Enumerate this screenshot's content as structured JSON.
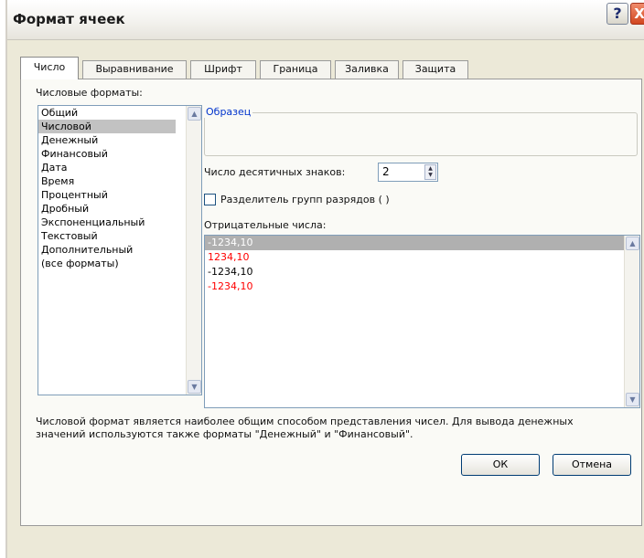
{
  "window": {
    "title": "Формат ячеек",
    "help_symbol": "?",
    "close_symbol": "X"
  },
  "tabs": [
    {
      "label": "Число",
      "active": true
    },
    {
      "label": "Выравнивание",
      "active": false
    },
    {
      "label": "Шрифт",
      "active": false
    },
    {
      "label": "Граница",
      "active": false
    },
    {
      "label": "Заливка",
      "active": false
    },
    {
      "label": "Защита",
      "active": false
    }
  ],
  "number_formats": {
    "label": "Числовые форматы:",
    "items": [
      "Общий",
      "Числовой",
      "Денежный",
      "Финансовый",
      "Дата",
      "Время",
      "Процентный",
      "Дробный",
      "Экспоненциальный",
      "Текстовый",
      "Дополнительный",
      "(все форматы)"
    ],
    "selected": "Числовой"
  },
  "sample": {
    "label": "Образец",
    "value": ""
  },
  "decimals": {
    "label": "Число десятичных знаков:",
    "value": "2"
  },
  "separator": {
    "label": "Разделитель групп разрядов ( )",
    "checked": false
  },
  "negative": {
    "label": "Отрицательные числа:",
    "items": [
      {
        "text": "-1234,10",
        "selected": true,
        "red": false
      },
      {
        "text": "1234,10",
        "selected": false,
        "red": true
      },
      {
        "text": "-1234,10",
        "selected": false,
        "red": false
      },
      {
        "text": "-1234,10",
        "selected": false,
        "red": true
      }
    ]
  },
  "description": "Числовой формат является наиболее общим способом представления чисел. Для вывода денежных значений используются также форматы \"Денежный\" и \"Финансовый\".",
  "buttons": {
    "ok": "ОК",
    "cancel": "Отмена"
  },
  "colors": {
    "accent_link": "#0033cc",
    "negative_red": "#ff0000",
    "selection": "#c2c2c2"
  }
}
